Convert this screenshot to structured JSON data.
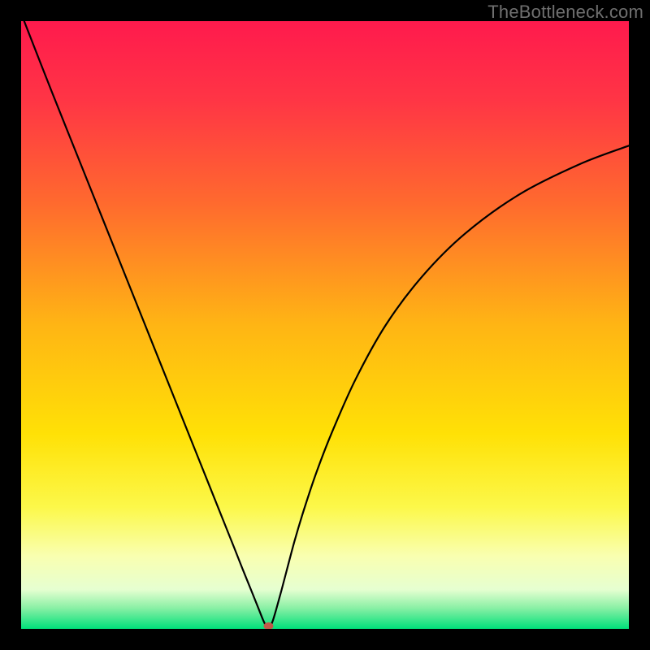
{
  "attribution": "TheBottleneck.com",
  "chart_data": {
    "type": "line",
    "title": "",
    "xlabel": "",
    "ylabel": "",
    "xlim": [
      0,
      100
    ],
    "ylim": [
      0,
      100
    ],
    "background_gradient": {
      "stops": [
        {
          "offset": 0.0,
          "color": "#ff1a4d"
        },
        {
          "offset": 0.13,
          "color": "#ff3545"
        },
        {
          "offset": 0.3,
          "color": "#ff6a2e"
        },
        {
          "offset": 0.5,
          "color": "#ffb514"
        },
        {
          "offset": 0.68,
          "color": "#ffe106"
        },
        {
          "offset": 0.8,
          "color": "#fcf84a"
        },
        {
          "offset": 0.88,
          "color": "#f9ffb0"
        },
        {
          "offset": 0.935,
          "color": "#e6ffd1"
        },
        {
          "offset": 0.965,
          "color": "#8cf0a6"
        },
        {
          "offset": 1.0,
          "color": "#00e07a"
        }
      ]
    },
    "series": [
      {
        "name": "bottleneck-curve",
        "color": "#000000",
        "width": 2.2,
        "x": [
          0.5,
          5,
          10,
          15,
          20,
          25,
          28,
          31,
          33,
          35,
          36.5,
          38,
          39,
          39.8,
          40.3,
          40.7,
          41.0,
          41.4,
          42.0,
          42.8,
          43.8,
          45.0,
          46.5,
          48.5,
          51,
          55,
          60,
          66,
          73,
          82,
          92,
          100
        ],
        "y": [
          100,
          88.5,
          76,
          63.5,
          51,
          38.5,
          31,
          23.5,
          18.5,
          13.5,
          9.7,
          6.0,
          3.5,
          1.5,
          0.5,
          0.15,
          0.4,
          1.3,
          3.3,
          6.2,
          10.0,
          14.5,
          19.5,
          25.5,
          32,
          41,
          50,
          58,
          65,
          71.5,
          76.5,
          79.5
        ]
      }
    ],
    "marker": {
      "name": "optimum-marker",
      "x": 40.7,
      "y": 0.0,
      "color": "#c15a4a",
      "rx": 6,
      "ry": 4.5
    }
  }
}
